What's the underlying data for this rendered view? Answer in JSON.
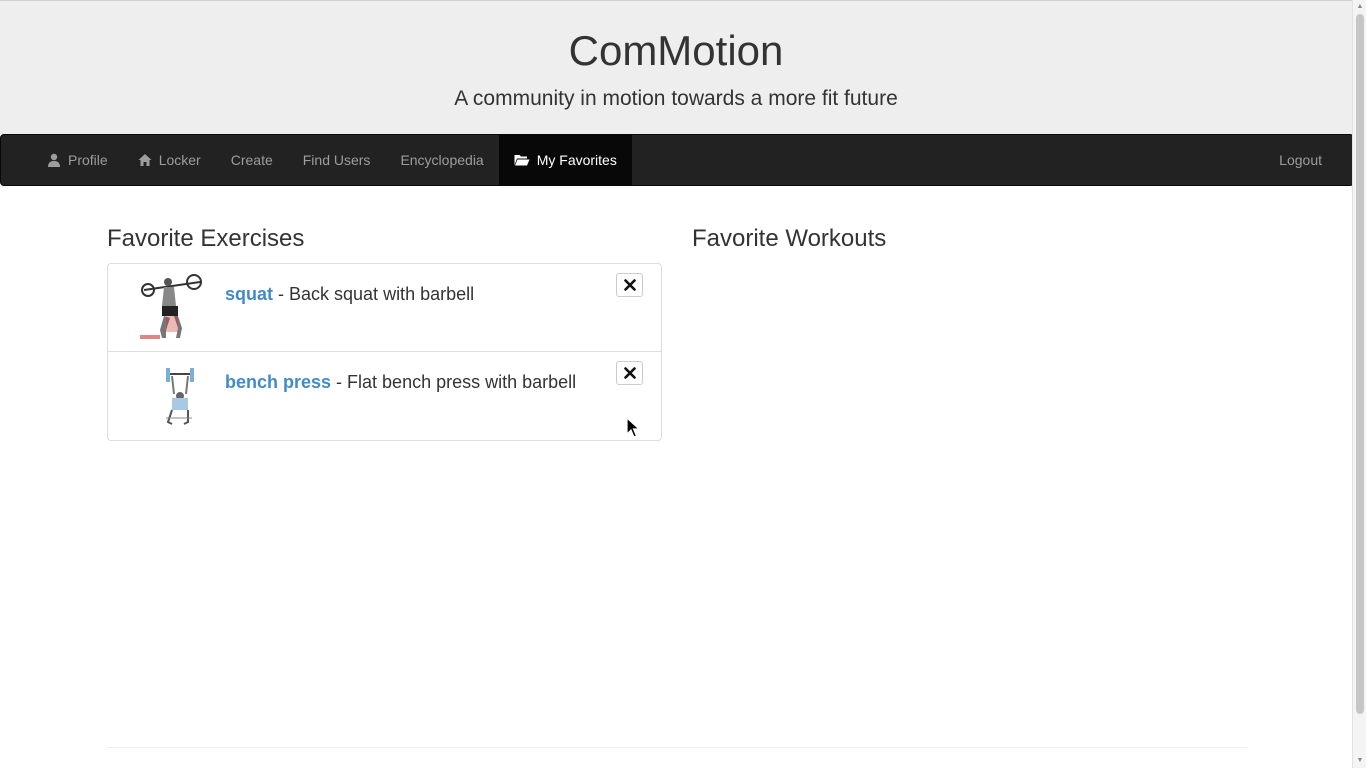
{
  "header": {
    "title": "ComMotion",
    "tagline": "A community in motion towards a more fit future"
  },
  "nav": {
    "items": [
      {
        "label": "Profile",
        "icon": "user-icon"
      },
      {
        "label": "Locker",
        "icon": "home-icon"
      },
      {
        "label": "Create"
      },
      {
        "label": "Find Users"
      },
      {
        "label": "Encyclopedia"
      },
      {
        "label": "My Favorites",
        "icon": "folder-open-icon",
        "active": true
      }
    ],
    "logout_label": "Logout"
  },
  "favorites": {
    "exercises_heading": "Favorite Exercises",
    "workouts_heading": "Favorite Workouts",
    "exercises": [
      {
        "name": "squat",
        "description": " - Back squat with barbell",
        "image": "squat-thumbnail"
      },
      {
        "name": "bench press",
        "description": " - Flat bench press with barbell",
        "image": "bench-press-thumbnail"
      }
    ],
    "workouts": []
  },
  "colors": {
    "link": "#428bca",
    "navbar": "#222222",
    "jumbotron": "#eeeeee"
  }
}
